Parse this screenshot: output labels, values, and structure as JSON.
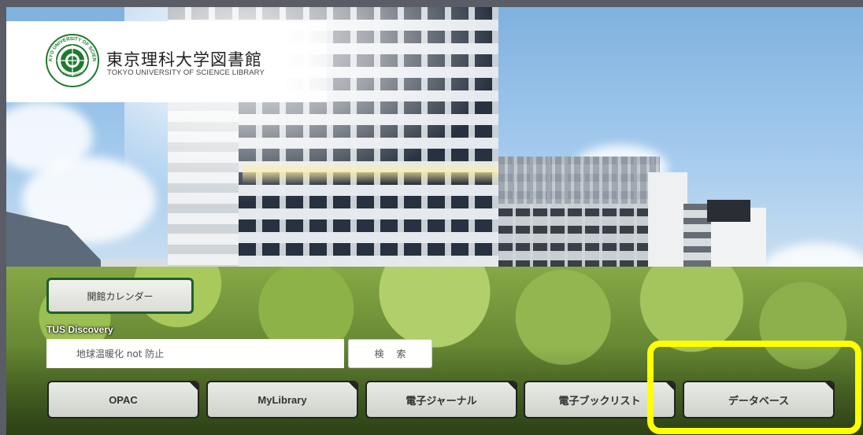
{
  "header": {
    "logo_icon": "university-seal-icon",
    "seal_text_top": "TOKYO UNIVERSITY OF SCIENCE",
    "seal_text_bottom": "since 1881",
    "title_ja": "東京理科大学図書館",
    "title_en": "TOKYO UNIVERSITY OF SCIENCE LIBRARY"
  },
  "calendar_button": {
    "label": "開館カレンダー"
  },
  "search": {
    "section_label": "TUS Discovery",
    "input_value": "地球温暖化 not 防止",
    "button_label": "検索"
  },
  "nav": [
    {
      "label": "OPAC"
    },
    {
      "label": "MyLibrary"
    },
    {
      "label": "電子ジャーナル"
    },
    {
      "label": "電子ブックリスト"
    },
    {
      "label": "データベース"
    }
  ],
  "colors": {
    "highlight": "#ffff00",
    "brand_green": "#1e7a2e",
    "calendar_border": "#1e5e2c"
  }
}
